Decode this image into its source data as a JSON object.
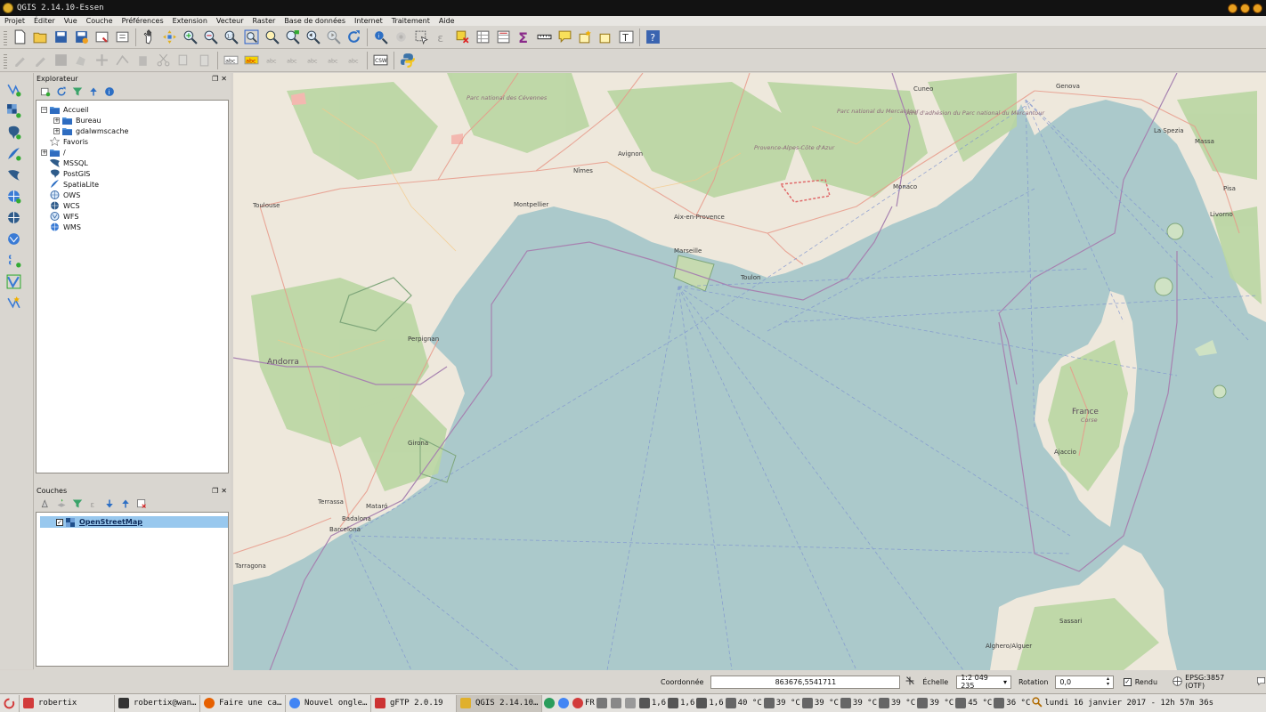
{
  "window": {
    "title": "QGIS 2.14.10-Essen"
  },
  "menu": [
    "Projet",
    "Éditer",
    "Vue",
    "Couche",
    "Préférences",
    "Extension",
    "Vecteur",
    "Raster",
    "Base de données",
    "Internet",
    "Traitement",
    "Aide"
  ],
  "toolbar2": {
    "csw_label": "CSW",
    "label_text": "abc"
  },
  "browser_panel": {
    "title": "Explorateur",
    "items": [
      {
        "label": "Accueil",
        "icon": "folder-icon"
      },
      {
        "label": "Bureau",
        "icon": "folder-icon"
      },
      {
        "label": "gdalwmscache",
        "icon": "folder-icon"
      },
      {
        "label": "Favoris",
        "icon": "star-icon"
      },
      {
        "label": "/",
        "icon": "folder-icon"
      },
      {
        "label": "MSSQL",
        "icon": "mssql-icon"
      },
      {
        "label": "PostGIS",
        "icon": "postgis-icon"
      },
      {
        "label": "SpatiaLite",
        "icon": "spatialite-icon"
      },
      {
        "label": "OWS",
        "icon": "globe-icon"
      },
      {
        "label": "WCS",
        "icon": "globe-icon"
      },
      {
        "label": "WFS",
        "icon": "globe-icon"
      },
      {
        "label": "WMS",
        "icon": "globe-icon"
      }
    ]
  },
  "layers_panel": {
    "title": "Couches",
    "layers": [
      {
        "name": "OpenStreetMap",
        "checked": true
      }
    ]
  },
  "map": {
    "places": [
      "Toulouse",
      "Montpellier",
      "Nîmes",
      "Avignon",
      "Aix-en-Provence",
      "Marseille",
      "Toulon",
      "Monaco",
      "Cuneo",
      "Genova",
      "La Spezia",
      "Massa",
      "Pisa",
      "Livorno",
      "Perpignan",
      "Andorra",
      "Girona",
      "Barcelona",
      "Tarragona",
      "Terrassa",
      "Mataró",
      "Badalona",
      "France",
      "Corse",
      "Ajaccio",
      "Sassari",
      "Alghero/Alguer"
    ],
    "regions": [
      "Parc national des Cévennes",
      "Provence-Alpes-Côte d'Azur",
      "Parc national du Mercantour",
      "Aire d'adhésion du Parc national du Mercantour"
    ]
  },
  "status": {
    "coord_label": "Coordonnée",
    "coord_value": "863676,5541711",
    "scale_label": "Échelle",
    "scale_value": "1:2 049 235",
    "rotation_label": "Rotation",
    "rotation_value": "0,0",
    "render_label": "Rendu",
    "render_checked": true,
    "crs": "EPSG:3857 (OTF)"
  },
  "taskbar": {
    "tasks": [
      {
        "label": "robertix",
        "icon_color": "#d23b3b"
      },
      {
        "label": "robertix@wan…",
        "icon_color": "#333333"
      },
      {
        "label": "Faire une ca…",
        "icon_color": "#e66000"
      },
      {
        "label": "Nouvel ongle…",
        "icon_color": "#4285f4"
      },
      {
        "label": "gFTP 2.0.19",
        "icon_color": "#c33"
      },
      {
        "label": "QGIS 2.14.10…",
        "icon_color": "#e0b02c"
      }
    ],
    "keyboard": "FR",
    "cpu": [
      "1,6",
      "1,6",
      "1,6"
    ],
    "temps": [
      "40 °C",
      "39 °C",
      "39 °C",
      "39 °C",
      "39 °C",
      "39 °C",
      "45 °C",
      "36 °C"
    ],
    "datetime": "lundi 16 janvier 2017 - 12h 57m 36s"
  }
}
